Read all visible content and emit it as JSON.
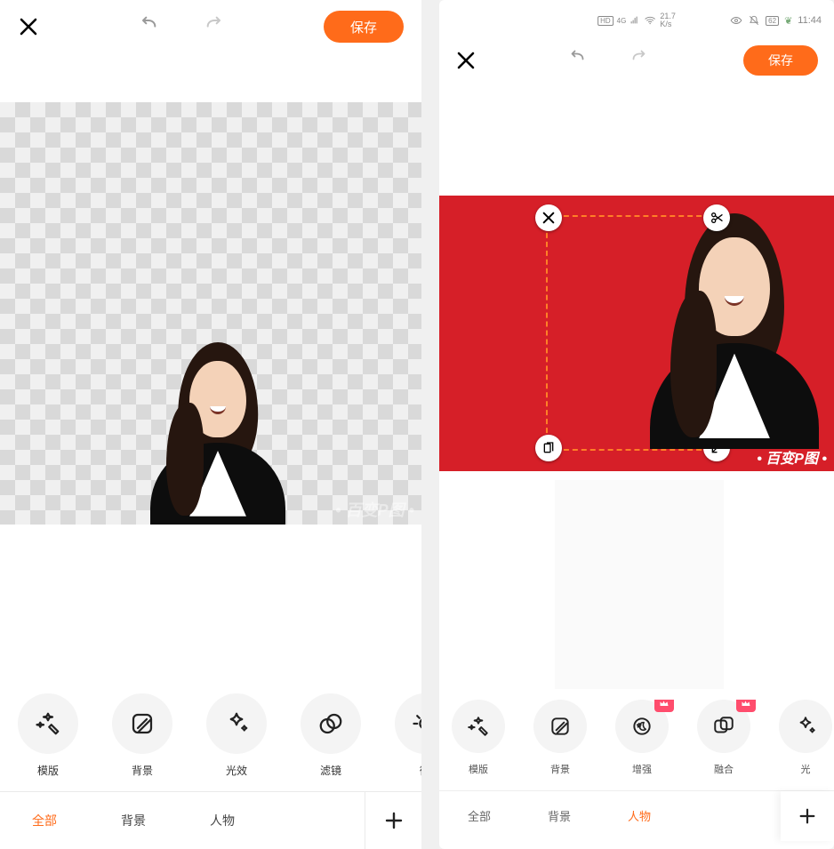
{
  "left": {
    "toolbar": {
      "save": "保存"
    },
    "watermark": "百变P图",
    "tools": [
      {
        "id": "template",
        "label": "模版",
        "icon": "wand"
      },
      {
        "id": "background",
        "label": "背景",
        "icon": "slashbox"
      },
      {
        "id": "light",
        "label": "光效",
        "icon": "star"
      },
      {
        "id": "filter",
        "label": "滤镜",
        "icon": "venn"
      },
      {
        "id": "fine",
        "label": "微",
        "icon": "sun",
        "partial": true
      }
    ],
    "tabs": [
      {
        "id": "all",
        "label": "全部",
        "active": true
      },
      {
        "id": "background",
        "label": "背景",
        "active": false
      },
      {
        "id": "person",
        "label": "人物",
        "active": false
      }
    ]
  },
  "right": {
    "status": {
      "net_speed_top": "21.7",
      "net_speed_unit": "K/s",
      "battery": "62",
      "time": "11:44"
    },
    "toolbar": {
      "save": "保存"
    },
    "canvas": {
      "bg_color": "#d61f28",
      "watermark": "百变P图"
    },
    "tools": [
      {
        "id": "template",
        "label": "模版",
        "icon": "wand",
        "vip": false
      },
      {
        "id": "background",
        "label": "背景",
        "icon": "slashbox",
        "vip": false
      },
      {
        "id": "enhance",
        "label": "增强",
        "icon": "moonstar",
        "vip": true
      },
      {
        "id": "blend",
        "label": "融合",
        "icon": "overlap",
        "vip": true
      },
      {
        "id": "light",
        "label": "光",
        "icon": "star",
        "vip": false,
        "partial": true
      }
    ],
    "tabs": [
      {
        "id": "all",
        "label": "全部",
        "active": false
      },
      {
        "id": "background",
        "label": "背景",
        "active": false
      },
      {
        "id": "person",
        "label": "人物",
        "active": true
      }
    ]
  }
}
